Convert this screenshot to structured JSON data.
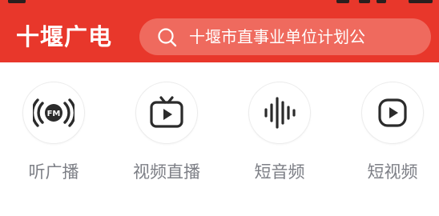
{
  "header": {
    "brand": "十堰广电",
    "search": {
      "placeholder": "十堰市直事业单位计划公",
      "icon": "search-icon"
    },
    "background": "#e8372b",
    "search_background": "#ef6a5e"
  },
  "quick_actions": [
    {
      "label": "听广播",
      "icon": "fm-radio-icon"
    },
    {
      "label": "视频直播",
      "icon": "tv-icon"
    },
    {
      "label": "短音频",
      "icon": "audio-wave-icon"
    },
    {
      "label": "短视频",
      "icon": "play-icon"
    }
  ],
  "colors": {
    "label_text": "#7d7f86",
    "icon_stroke": "#2b2b2b"
  }
}
